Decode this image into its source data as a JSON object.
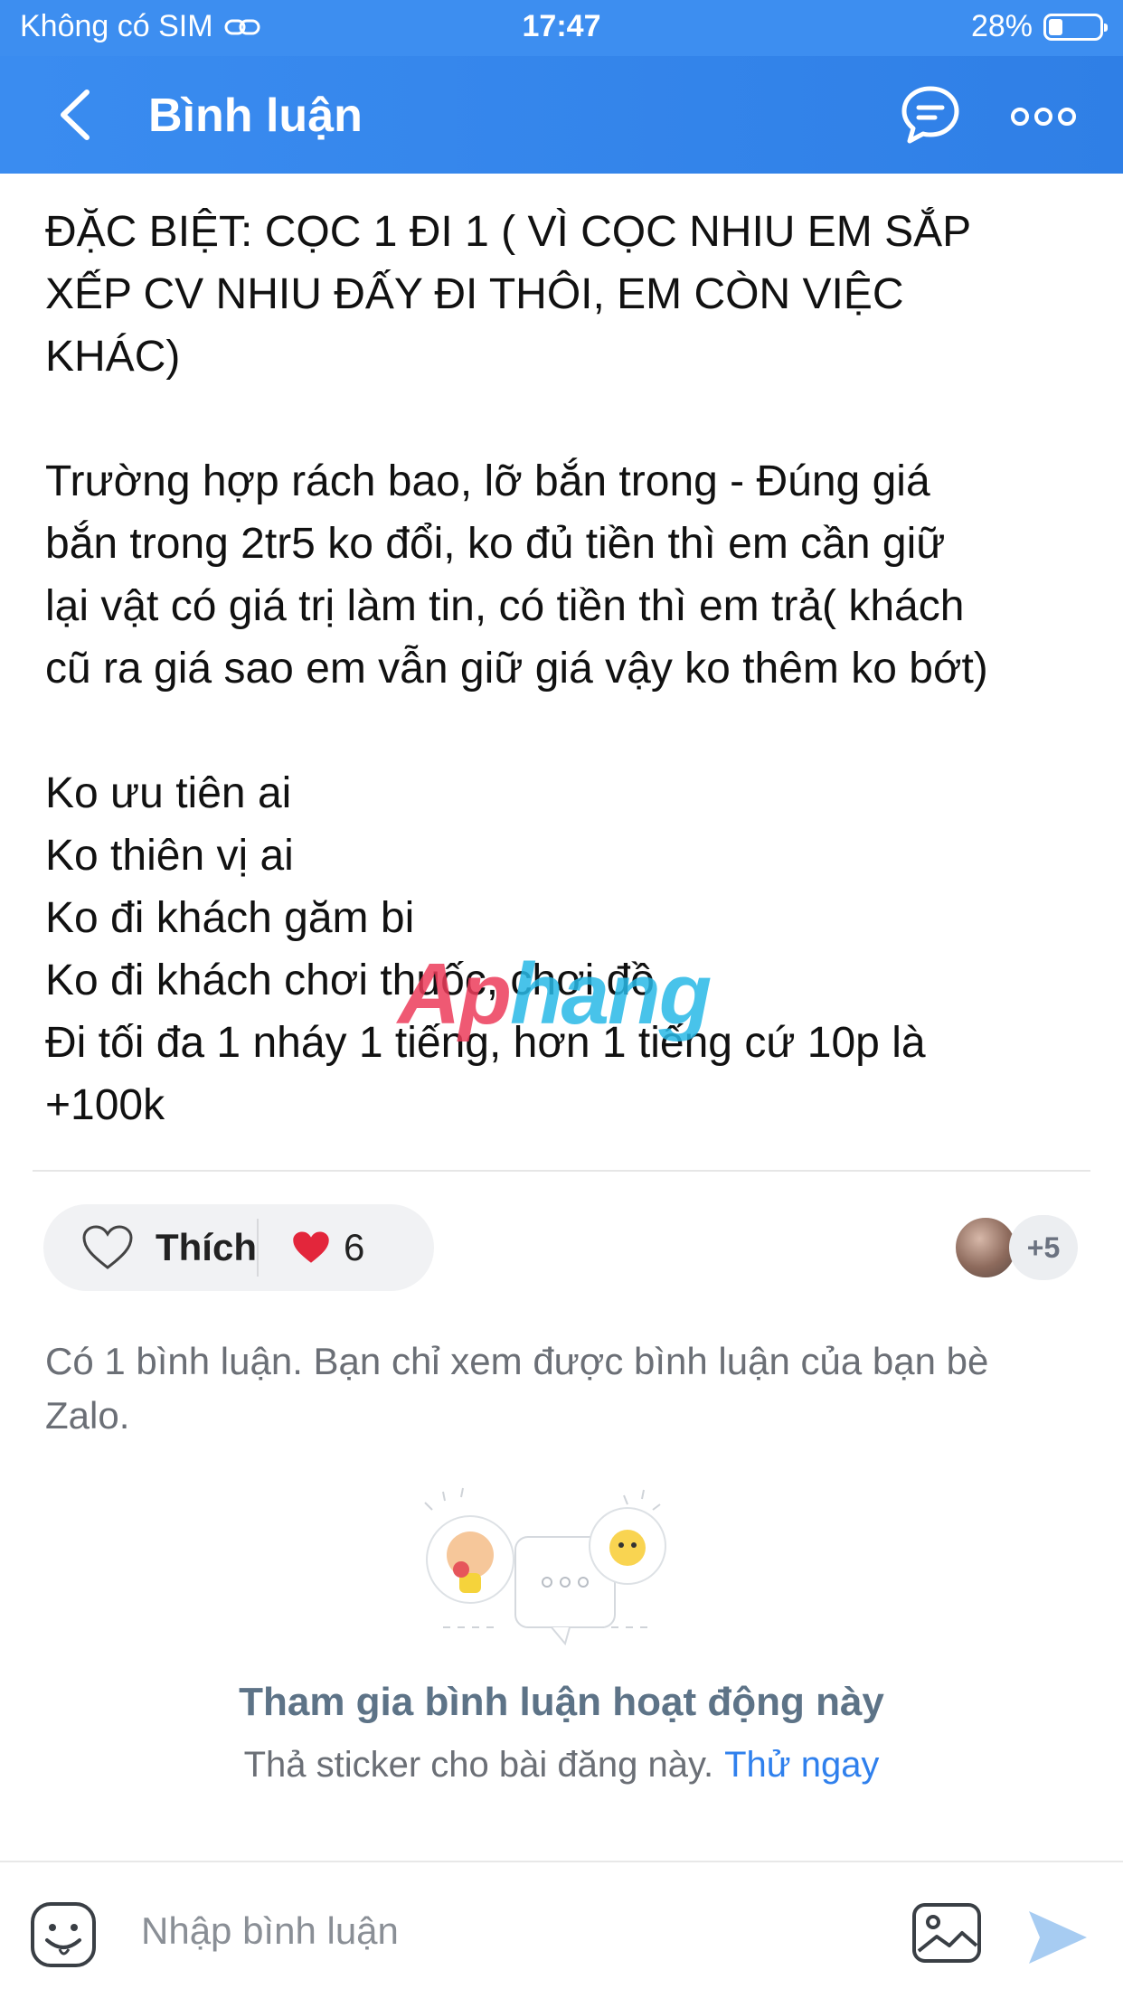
{
  "status_bar": {
    "carrier": "Không có SIM",
    "time": "17:47",
    "battery": "28%",
    "battery_level": 0.28
  },
  "nav": {
    "title": "Bình luận",
    "back_icon": "chevron-left-icon",
    "chat_icon": "chat-bubble-icon",
    "more_icon": "more-dots-icon"
  },
  "post": {
    "text": "ĐẶC BIỆT: CỌC 1 ĐI 1 ( VÌ CỌC NHIU EM SẮP\nXẾP CV NHIU ĐẤY ĐI THÔI, EM CÒN VIỆC\nKHÁC)\n\nTrường hợp rách bao, lỡ bắn trong - Đúng giá\nbắn trong 2tr5 ko đổi, ko đủ tiền thì em cần giữ\nlại vật có giá trị làm tin, có tiền thì em trả( khách\ncũ ra giá sao em vẫn giữ giá vậy ko thêm ko bớt)\n\nKo ưu tiên ai\nKo thiên vị ai\nKo đi khách găm bi\nKo đi khách chơi thuốc, chơi đồ\nĐi tối đa 1 nháy 1 tiếng, hơn 1 tiếng cứ 10p là\n+100k",
    "watermark_a": "Ap",
    "watermark_b": "hang"
  },
  "reactions": {
    "like_label": "Thích",
    "heart_count": "6",
    "more_count": "+5",
    "heart_color": "#e3263b"
  },
  "comments": {
    "note": "Có 1 bình luận. Bạn chỉ xem được bình luận của bạn bè Zalo.",
    "invite_title": "Tham gia bình luận hoạt động này",
    "invite_sub": "Thả sticker cho bài đăng này.",
    "invite_link": "Thử ngay"
  },
  "composer": {
    "placeholder": "Nhập bình luận",
    "emoji_icon": "emoji-icon",
    "photo_icon": "image-icon",
    "send_icon": "send-icon"
  },
  "colors": {
    "accent": "#3d8ef0",
    "link": "#2f80ed"
  }
}
